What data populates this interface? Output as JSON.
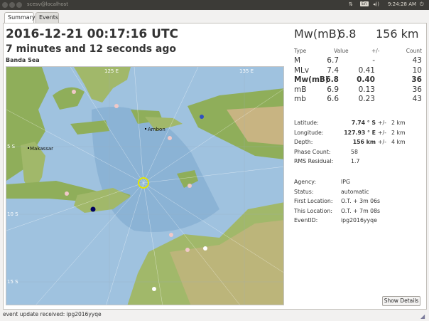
{
  "window": {
    "title": "scesv@localhost",
    "kbd": "En",
    "volume": "◂))",
    "clock": "9:24:28 AM",
    "power": "⏻",
    "net": "⇅"
  },
  "tabs": [
    {
      "label": "Summary"
    },
    {
      "label": "Events"
    }
  ],
  "event": {
    "time": "2016-12-21 00:17:16 UTC",
    "ago": "7 minutes and 12 seconds ago",
    "region": "Banda Sea",
    "mag_type": "Mw(mB)",
    "mag_value": "6.8",
    "depth_head": "156 km"
  },
  "mag_table": {
    "headers": {
      "type": "Type",
      "value": "Value",
      "pm": "+/-",
      "count": "Count"
    },
    "rows": [
      {
        "type": "M",
        "value": "6.7",
        "pm": "-",
        "count": "43",
        "bold": false
      },
      {
        "type": "MLv",
        "value": "7.4",
        "pm": "0.41",
        "count": "10",
        "bold": false
      },
      {
        "type": "Mw(mB)",
        "value": "6.8",
        "pm": "0.40",
        "count": "36",
        "bold": true
      },
      {
        "type": "mB",
        "value": "6.9",
        "pm": "0.13",
        "count": "36",
        "bold": false
      },
      {
        "type": "mb",
        "value": "6.6",
        "pm": "0.23",
        "count": "43",
        "bold": false
      }
    ]
  },
  "location": {
    "latitude_label": "Latitude:",
    "latitude": "7.74 ° S",
    "latitude_pm": "+/-",
    "latitude_err": "2 km",
    "longitude_label": "Longitude:",
    "longitude": "127.93 ° E",
    "longitude_pm": "+/-",
    "longitude_err": "2 km",
    "depth_label": "Depth:",
    "depth": "156 km",
    "depth_pm": "+/-",
    "depth_err": "4 km",
    "phase_label": "Phase Count:",
    "phase": "58",
    "rms_label": "RMS Residual:",
    "rms": "1.7"
  },
  "meta": {
    "agency_label": "Agency:",
    "agency": "IPG",
    "status_label": "Status:",
    "status": "automatic",
    "first_label": "First Location:",
    "first": "O.T. + 3m 06s",
    "this_label": "This Location:",
    "this": "O.T. + 7m 08s",
    "eventid_label": "EventID:",
    "eventid": "ipg2016yyqe"
  },
  "map": {
    "lon_labels": [
      "125 E",
      "135 E"
    ],
    "lat_labels": [
      "5 S",
      "10 S",
      "15 S"
    ],
    "cities": [
      "Ambon",
      "Makassar"
    ],
    "ocean_color": "#9fc2df",
    "land_color": "#8fae5a",
    "epicenter_color": "#e6e600"
  },
  "show_details": "Show Details",
  "statusbar": "event update received: ipg2016yyqe"
}
